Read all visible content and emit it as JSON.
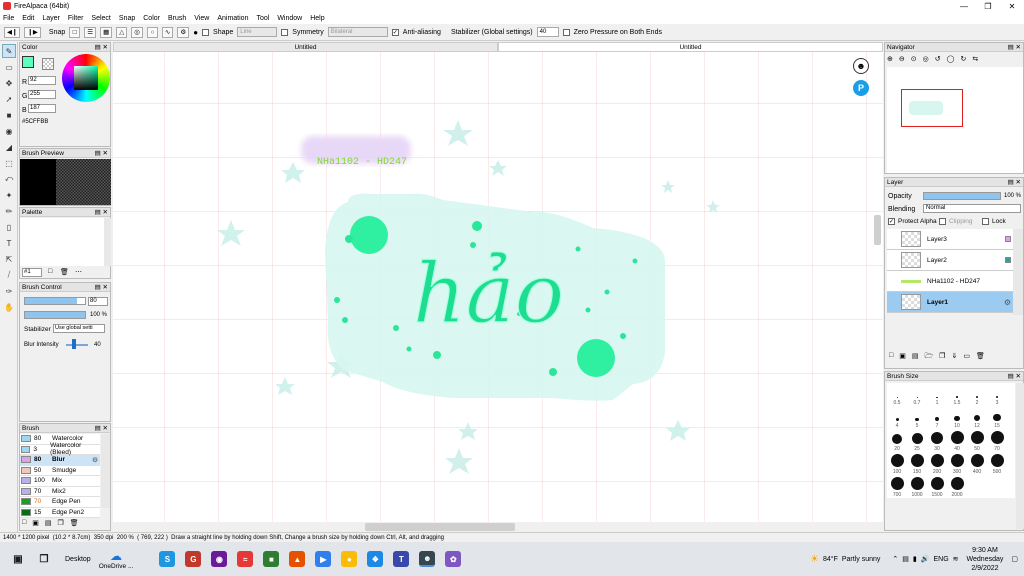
{
  "window": {
    "title": "FireAlpaca (64bit)"
  },
  "menu": [
    "File",
    "Edit",
    "Layer",
    "Filter",
    "Select",
    "Snap",
    "Color",
    "Brush",
    "View",
    "Animation",
    "Tool",
    "Window",
    "Help"
  ],
  "toolbar": {
    "snap_label": "Snap",
    "shape_label": "Shape",
    "shape_value": "Line",
    "symmetry_label": "Symmetry",
    "symmetry_value": "Bilateral",
    "antialias_label": "Anti-aliasing",
    "stabilizer_label": "Stabilizer (Global settings)",
    "stabilizer_value": "40",
    "zero_pressure_label": "Zero Pressure on Both Ends"
  },
  "tabs": [
    "Untitled",
    "Untitled"
  ],
  "color_panel": {
    "title": "Color",
    "r_label": "R",
    "r": "92",
    "g_label": "G",
    "g": "255",
    "b_label": "B",
    "b": "187",
    "hex": "#5CFFBB",
    "current_color": "#5CFFBB"
  },
  "brush_preview": {
    "title": "Brush Preview"
  },
  "palette": {
    "title": "Palette",
    "selector": "#1"
  },
  "brush_control": {
    "title": "Brush Control",
    "size": "80",
    "opacity": "100 %",
    "stabilizer_label": "Stabilizer",
    "stabilizer_value": "Use global setti",
    "blur_label": "Blur Intensity",
    "blur_value": "40"
  },
  "brush_panel": {
    "title": "Brush",
    "items": [
      {
        "size": "80",
        "name": "Watercolor",
        "color": "#9fd6f0"
      },
      {
        "size": "3",
        "name": "Watercolor (Bleed)",
        "color": "#9fd6f0"
      },
      {
        "size": "80",
        "name": "Blur",
        "color": "#e0a0e8"
      },
      {
        "size": "50",
        "name": "Smudge",
        "color": "#f0c8b8"
      },
      {
        "size": "100",
        "name": "Mix",
        "color": "#b8b0e8"
      },
      {
        "size": "70",
        "name": "Mix2",
        "color": "#b8b0e8"
      },
      {
        "size": "70",
        "name": "Edge Pen",
        "color": "#18a020"
      },
      {
        "size": "15",
        "name": "Edge Pen2",
        "color": "#0a6a18"
      }
    ]
  },
  "canvas": {
    "watermark": "NHa1102 - HD247",
    "lettering": "hảo"
  },
  "navigator": {
    "title": "Navigator"
  },
  "layer_panel": {
    "title": "Layer",
    "opacity_label": "Opacity",
    "opacity_value": "100 %",
    "blending_label": "Blending",
    "blending_value": "Normal",
    "protect_alpha": "Protect Alpha",
    "clipping": "Clipping",
    "lock": "Lock",
    "layers": [
      "Layer3",
      "Layer2",
      "NHa1102 - HD247",
      "Layer1"
    ]
  },
  "brush_size": {
    "title": "Brush Size",
    "sizes": [
      "0.5",
      "0.7",
      "1",
      "1.5",
      "2",
      "3",
      "4",
      "5",
      "7",
      "10",
      "12",
      "15",
      "20",
      "25",
      "30",
      "40",
      "50",
      "70",
      "100",
      "150",
      "200",
      "300",
      "400",
      "500",
      "700",
      "1000",
      "1500",
      "2000"
    ]
  },
  "status": {
    "dims": "1400 * 1200 pixel",
    "cm": "(10.2 * 8.7cm)",
    "dpi": "350 dpi",
    "zoom": "200 %",
    "coords": "( 769, 222 )",
    "hint": "Draw a straight line by holding down Shift, Change a brush size by holding down Ctrl, Alt, and dragging"
  },
  "taskbar": {
    "desktop": "Desktop",
    "onedrive": "OneDrive ...",
    "weather_temp": "84°F",
    "weather_text": "Partly sunny",
    "lang": "ENG",
    "time": "9:30 AM",
    "day": "Wednesday",
    "date": "2/9/2022"
  }
}
